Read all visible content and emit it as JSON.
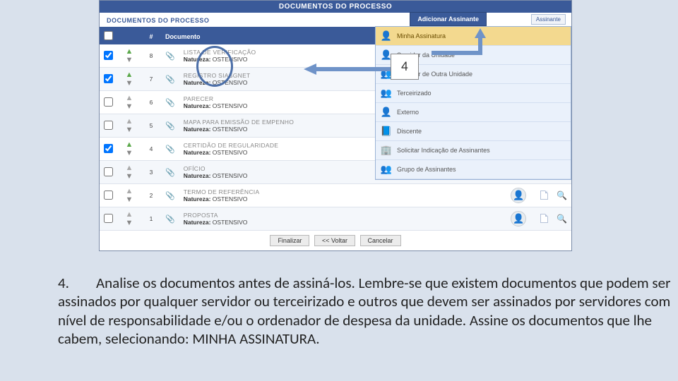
{
  "header": {
    "banner_title": "DOCUMENTOS DO PROCESSO",
    "panel_title": "DOCUMENTOS DO PROCESSO",
    "add_signer_button": "Adicionar Assinante",
    "right_box_label": "Assinante"
  },
  "dropdown": {
    "items": [
      {
        "label": "Minha Assinatura",
        "highlight": true,
        "icon": "user-icon",
        "color": "orange"
      },
      {
        "label": "Servidor da Unidade",
        "icon": "user-icon",
        "color": "blue"
      },
      {
        "label": "Servidor de Outra Unidade",
        "icon": "users-icon",
        "color": "blue"
      },
      {
        "label": "Terceirizado",
        "icon": "users-icon",
        "color": "teal"
      },
      {
        "label": "Externo",
        "icon": "user-icon",
        "color": "grey"
      },
      {
        "label": "Discente",
        "icon": "book-icon",
        "color": "purple"
      },
      {
        "label": "Solicitar Indicação de Assinantes",
        "icon": "building-icon",
        "color": "grey"
      },
      {
        "label": "Grupo de Assinantes",
        "icon": "users-icon",
        "color": "blue"
      }
    ]
  },
  "table": {
    "header": {
      "num": "#",
      "doc": "Documento"
    },
    "rows": [
      {
        "checked": true,
        "num": "8",
        "title": "LISTA DE VERIFICAÇÃO",
        "nat_label": "Natureza:",
        "nat_value": "OSTENSIVO",
        "dots": true,
        "avatar": false,
        "page": true,
        "mag": false,
        "gear": true
      },
      {
        "checked": true,
        "num": "7",
        "title": "REGISTRO SIASGNET",
        "nat_label": "Natureza:",
        "nat_value": "OSTENSIVO",
        "dots": true,
        "avatar": false,
        "page": true,
        "mag": false,
        "gear": true
      },
      {
        "checked": false,
        "num": "6",
        "title": "PARECER",
        "nat_label": "Natureza:",
        "nat_value": "OSTENSIVO",
        "dots": true,
        "avatar": false,
        "page": true,
        "mag": false,
        "gear": true
      },
      {
        "checked": false,
        "num": "5",
        "title": "MAPA PARA EMISSÃO DE EMPENHO",
        "nat_label": "Natureza:",
        "nat_value": "OSTENSIVO",
        "dots": false,
        "avatar": false,
        "page": true,
        "mag": false,
        "gear": true
      },
      {
        "checked": true,
        "num": "4",
        "title": "CERTIDÃO DE REGULARIDADE",
        "nat_label": "Natureza:",
        "nat_value": "OSTENSIVO",
        "dots": true,
        "avatar": false,
        "page": true,
        "mag": false,
        "gear": true
      },
      {
        "checked": false,
        "num": "3",
        "title": "OFÍCIO",
        "nat_label": "Natureza:",
        "nat_value": "OSTENSIVO",
        "dots": false,
        "avatar": true,
        "page": true,
        "mag": true,
        "gear": false
      },
      {
        "checked": false,
        "num": "2",
        "title": "TERMO DE REFERÊNCIA",
        "nat_label": "Natureza:",
        "nat_value": "OSTENSIVO",
        "dots": false,
        "avatar": true,
        "page": true,
        "mag": true,
        "gear": false
      },
      {
        "checked": false,
        "num": "1",
        "title": "PROPOSTA",
        "nat_label": "Natureza:",
        "nat_value": "OSTENSIVO",
        "dots": false,
        "avatar": true,
        "page": true,
        "mag": true,
        "gear": false
      }
    ]
  },
  "footer": {
    "finalize": "Finalizar",
    "back": "<< Voltar",
    "cancel": "Cancelar"
  },
  "annotation": {
    "callout_number": "4",
    "instruction_number": "4.",
    "instruction_text": "Analise os documentos antes de assiná-los. Lembre-se que existem documentos que podem ser assinados por qualquer servidor ou terceirizado e outros que devem ser assinados por servidores com nível de responsabilidade e/ou o ordenador de despesa da unidade. Assine os documentos que lhe cabem, selecionando: MINHA ASSINATURA."
  }
}
